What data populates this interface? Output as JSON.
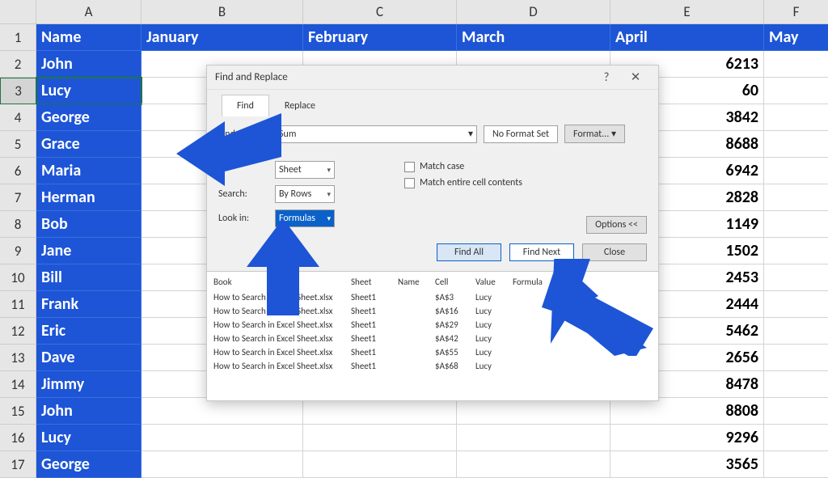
{
  "columns": {
    "A": "A",
    "B": "B",
    "C": "C",
    "D": "D",
    "E": "E",
    "F": "F"
  },
  "headers": {
    "A": "Name",
    "B": "January",
    "C": "February",
    "D": "March",
    "E": "April",
    "F": "May"
  },
  "rows": [
    {
      "n": "2",
      "name": "John",
      "e": "6213"
    },
    {
      "n": "3",
      "name": "Lucy",
      "e": "60"
    },
    {
      "n": "4",
      "name": "George",
      "e": "3842"
    },
    {
      "n": "5",
      "name": "Grace",
      "e": "8688"
    },
    {
      "n": "6",
      "name": "Maria",
      "e": "6942"
    },
    {
      "n": "7",
      "name": "Herman",
      "e": "2828"
    },
    {
      "n": "8",
      "name": "Bob",
      "e": "1149"
    },
    {
      "n": "9",
      "name": "Jane",
      "e": "1502"
    },
    {
      "n": "10",
      "name": "Bill",
      "e": "2453"
    },
    {
      "n": "11",
      "name": "Frank",
      "e": "2444"
    },
    {
      "n": "12",
      "name": "Eric",
      "e": "5462"
    },
    {
      "n": "13",
      "name": "Dave",
      "e": "2656"
    },
    {
      "n": "14",
      "name": "Jimmy",
      "e": "8478"
    },
    {
      "n": "15",
      "name": "John",
      "e": "8808"
    },
    {
      "n": "16",
      "name": "Lucy",
      "e": "9296"
    },
    {
      "n": "17",
      "name": "George",
      "e": "3565"
    }
  ],
  "dialog": {
    "title": "Find and Replace",
    "help": "?",
    "close": "✕",
    "tabs": {
      "find": "Find",
      "replace": "Replace"
    },
    "findwhat_label": "Find what:",
    "findwhat_value": "Sum",
    "noformat": "No Format Set",
    "format": "Format...",
    "within_label": "",
    "within_value": "Sheet",
    "search_label": "Search:",
    "search_value": "By Rows",
    "lookin_label": "Look in:",
    "lookin_value": "Formulas",
    "matchcase": "Match case",
    "matchentire": "Match entire cell contents",
    "options": "Options <<",
    "findall": "Find All",
    "findnext": "Find Next",
    "closebtn": "Close"
  },
  "results": {
    "hdr": {
      "book": "Book",
      "sheet": "Sheet",
      "name": "Name",
      "cell": "Cell",
      "value": "Value",
      "formula": "Formula"
    },
    "rows": [
      {
        "book": "How to Search in Excel Sheet.xlsx",
        "sheet": "Sheet1",
        "name": "",
        "cell": "$A$3",
        "value": "Lucy",
        "formula": ""
      },
      {
        "book": "How to Search in Excel Sheet.xlsx",
        "sheet": "Sheet1",
        "name": "",
        "cell": "$A$16",
        "value": "Lucy",
        "formula": ""
      },
      {
        "book": "How to Search in Excel Sheet.xlsx",
        "sheet": "Sheet1",
        "name": "",
        "cell": "$A$29",
        "value": "Lucy",
        "formula": ""
      },
      {
        "book": "How to Search in Excel Sheet.xlsx",
        "sheet": "Sheet1",
        "name": "",
        "cell": "$A$42",
        "value": "Lucy",
        "formula": ""
      },
      {
        "book": "How to Search in Excel Sheet.xlsx",
        "sheet": "Sheet1",
        "name": "",
        "cell": "$A$55",
        "value": "Lucy",
        "formula": ""
      },
      {
        "book": "How to Search in Excel Sheet.xlsx",
        "sheet": "Sheet1",
        "name": "",
        "cell": "$A$68",
        "value": "Lucy",
        "formula": ""
      }
    ]
  }
}
